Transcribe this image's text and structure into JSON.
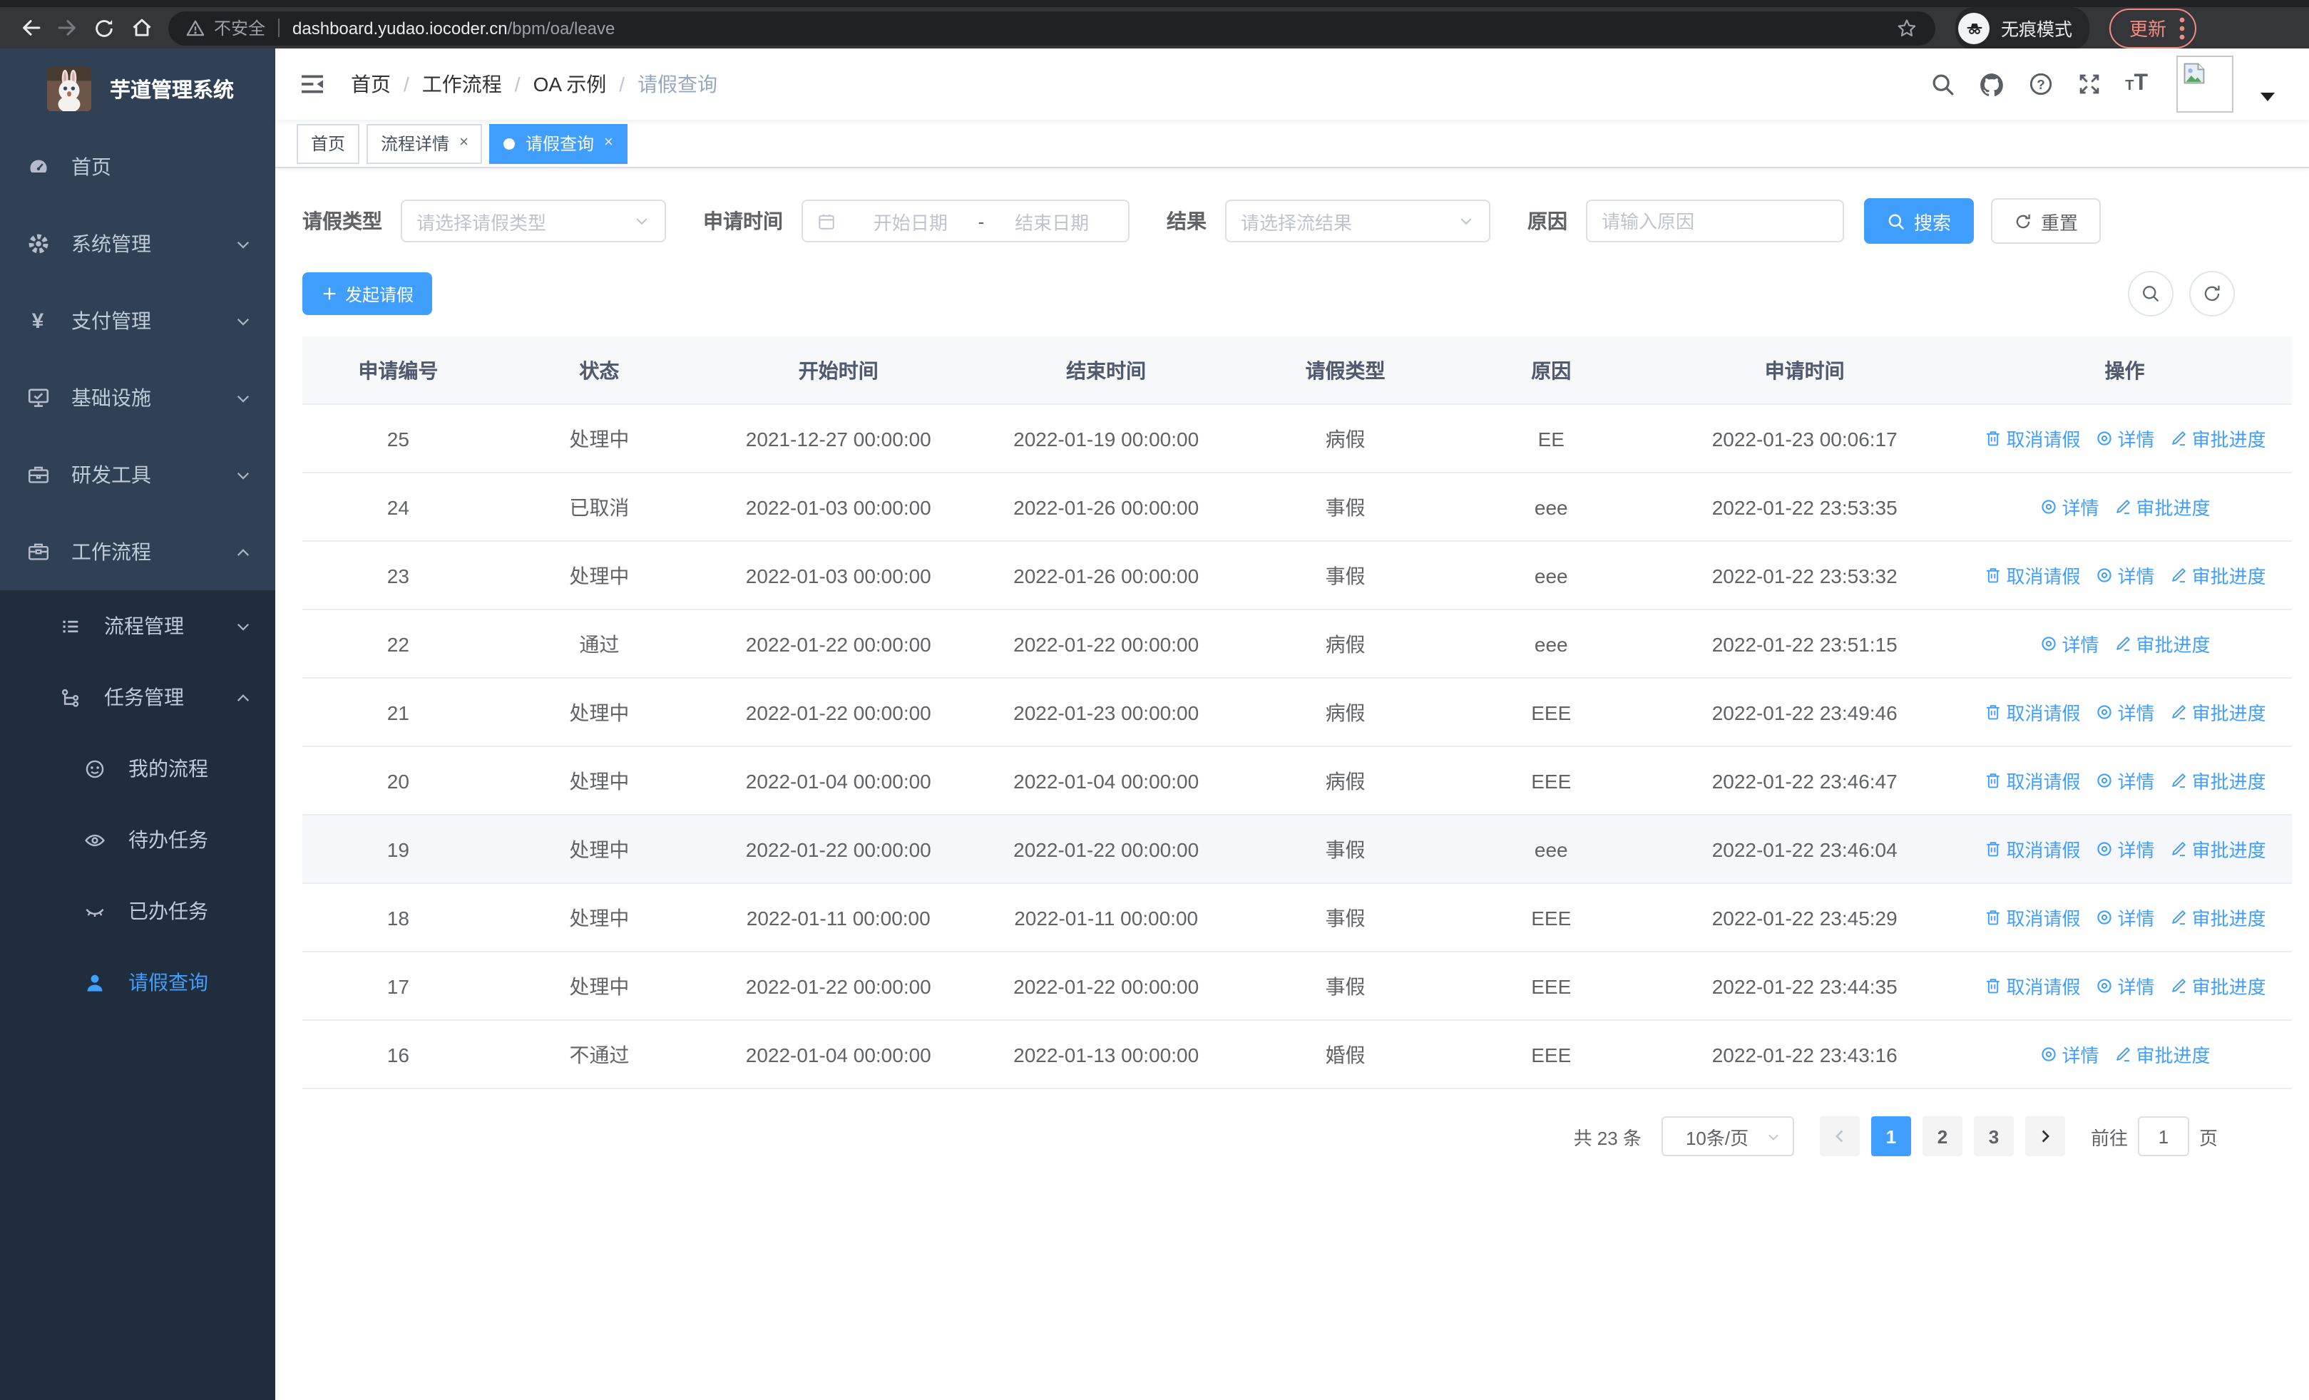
{
  "colors": {
    "primary": "#409eff",
    "sidebar_bg": "#304156",
    "submenu_bg": "#1f2d3d",
    "chrome_accent": "#f28b82"
  },
  "browser": {
    "security_warning": "不安全",
    "url_host": "dashboard.yudao.iocoder.cn",
    "url_path": "/bpm/oa/leave",
    "incognito_label": "无痕模式",
    "update_button": "更新"
  },
  "sidebar": {
    "app_title": "芋道管理系统",
    "items": [
      {
        "key": "home",
        "label": "首页",
        "icon": "dashboard-icon",
        "expandable": false
      },
      {
        "key": "system-management",
        "label": "系统管理",
        "icon": "gear-icon",
        "expandable": true,
        "expanded": false
      },
      {
        "key": "payment-management",
        "label": "支付管理",
        "icon": "yen-icon",
        "expandable": true,
        "expanded": false
      },
      {
        "key": "infrastructure",
        "label": "基础设施",
        "icon": "monitor-icon",
        "expandable": true,
        "expanded": false
      },
      {
        "key": "dev-tools",
        "label": "研发工具",
        "icon": "toolbox-icon",
        "expandable": true,
        "expanded": false
      },
      {
        "key": "workflow",
        "label": "工作流程",
        "icon": "briefcase-icon",
        "expandable": true,
        "expanded": true
      }
    ],
    "submenu": [
      {
        "key": "process-management",
        "label": "流程管理",
        "icon": "list-icon",
        "level": 2,
        "expandable": true,
        "expanded": false
      },
      {
        "key": "task-management",
        "label": "任务管理",
        "icon": "tree-icon",
        "level": 2,
        "expandable": true,
        "expanded": true
      },
      {
        "key": "my-processes",
        "label": "我的流程",
        "icon": "face-icon",
        "level": 3
      },
      {
        "key": "todo-tasks",
        "label": "待办任务",
        "icon": "eye-icon",
        "level": 3
      },
      {
        "key": "done-tasks",
        "label": "已办任务",
        "icon": "eye-closed-icon",
        "level": 3
      },
      {
        "key": "leave-query",
        "label": "请假查询",
        "icon": "user-icon",
        "level": 3,
        "active": true
      }
    ]
  },
  "header": {
    "breadcrumb": [
      "首页",
      "工作流程",
      "OA 示例",
      "请假查询"
    ]
  },
  "tabs": [
    {
      "key": "home",
      "label": "首页",
      "closable": false,
      "active": false
    },
    {
      "key": "process-detail",
      "label": "流程详情",
      "closable": true,
      "active": false
    },
    {
      "key": "leave-query",
      "label": "请假查询",
      "closable": true,
      "active": true
    }
  ],
  "filters": {
    "leave_type": {
      "label": "请假类型",
      "placeholder": "请选择请假类型"
    },
    "apply_time": {
      "label": "申请时间",
      "start_placeholder": "开始日期",
      "separator": "-",
      "end_placeholder": "结束日期"
    },
    "result": {
      "label": "结果",
      "placeholder": "请选择流结果"
    },
    "reason": {
      "label": "原因",
      "placeholder": "请输入原因"
    },
    "search_button": "搜索",
    "reset_button": "重置"
  },
  "toolbar": {
    "create_button": "发起请假"
  },
  "table": {
    "columns": [
      "申请编号",
      "状态",
      "开始时间",
      "结束时间",
      "请假类型",
      "原因",
      "申请时间",
      "操作"
    ],
    "action_labels": {
      "cancel": "取消请假",
      "detail": "详情",
      "progress": "审批进度"
    },
    "rows": [
      {
        "id": "25",
        "status": "处理中",
        "start": "2021-12-27 00:00:00",
        "end": "2022-01-19 00:00:00",
        "type": "病假",
        "reason": "EE",
        "applied": "2022-01-23 00:06:17",
        "actions": [
          "cancel",
          "detail",
          "progress"
        ],
        "hover": false
      },
      {
        "id": "24",
        "status": "已取消",
        "start": "2022-01-03 00:00:00",
        "end": "2022-01-26 00:00:00",
        "type": "事假",
        "reason": "eee",
        "applied": "2022-01-22 23:53:35",
        "actions": [
          "detail",
          "progress"
        ],
        "hover": false
      },
      {
        "id": "23",
        "status": "处理中",
        "start": "2022-01-03 00:00:00",
        "end": "2022-01-26 00:00:00",
        "type": "事假",
        "reason": "eee",
        "applied": "2022-01-22 23:53:32",
        "actions": [
          "cancel",
          "detail",
          "progress"
        ],
        "hover": false
      },
      {
        "id": "22",
        "status": "通过",
        "start": "2022-01-22 00:00:00",
        "end": "2022-01-22 00:00:00",
        "type": "病假",
        "reason": "eee",
        "applied": "2022-01-22 23:51:15",
        "actions": [
          "detail",
          "progress"
        ],
        "hover": false
      },
      {
        "id": "21",
        "status": "处理中",
        "start": "2022-01-22 00:00:00",
        "end": "2022-01-23 00:00:00",
        "type": "病假",
        "reason": "EEE",
        "applied": "2022-01-22 23:49:46",
        "actions": [
          "cancel",
          "detail",
          "progress"
        ],
        "hover": false
      },
      {
        "id": "20",
        "status": "处理中",
        "start": "2022-01-04 00:00:00",
        "end": "2022-01-04 00:00:00",
        "type": "病假",
        "reason": "EEE",
        "applied": "2022-01-22 23:46:47",
        "actions": [
          "cancel",
          "detail",
          "progress"
        ],
        "hover": false
      },
      {
        "id": "19",
        "status": "处理中",
        "start": "2022-01-22 00:00:00",
        "end": "2022-01-22 00:00:00",
        "type": "事假",
        "reason": "eee",
        "applied": "2022-01-22 23:46:04",
        "actions": [
          "cancel",
          "detail",
          "progress"
        ],
        "hover": true
      },
      {
        "id": "18",
        "status": "处理中",
        "start": "2022-01-11 00:00:00",
        "end": "2022-01-11 00:00:00",
        "type": "事假",
        "reason": "EEE",
        "applied": "2022-01-22 23:45:29",
        "actions": [
          "cancel",
          "detail",
          "progress"
        ],
        "hover": false
      },
      {
        "id": "17",
        "status": "处理中",
        "start": "2022-01-22 00:00:00",
        "end": "2022-01-22 00:00:00",
        "type": "事假",
        "reason": "EEE",
        "applied": "2022-01-22 23:44:35",
        "actions": [
          "cancel",
          "detail",
          "progress"
        ],
        "hover": false
      },
      {
        "id": "16",
        "status": "不通过",
        "start": "2022-01-04 00:00:00",
        "end": "2022-01-13 00:00:00",
        "type": "婚假",
        "reason": "EEE",
        "applied": "2022-01-22 23:43:16",
        "actions": [
          "detail",
          "progress"
        ],
        "hover": false
      }
    ]
  },
  "pagination": {
    "total": "共 23 条",
    "page_size": "10条/页",
    "pages": [
      "1",
      "2",
      "3"
    ],
    "active_page": "1",
    "goto_label": "前往",
    "goto_value": "1",
    "page_suffix": "页"
  }
}
